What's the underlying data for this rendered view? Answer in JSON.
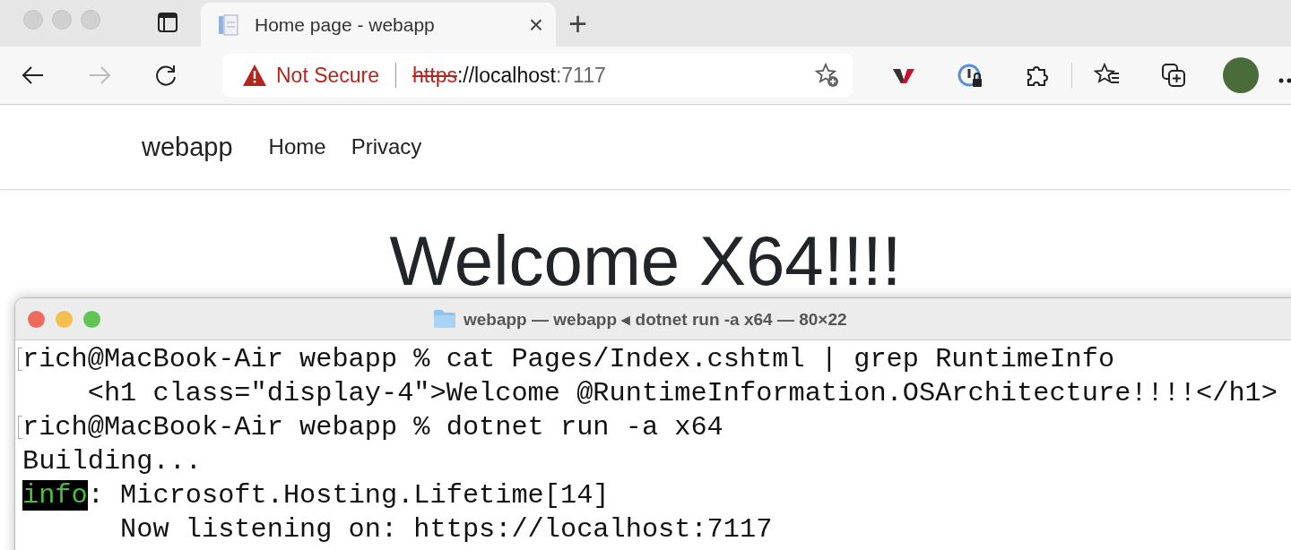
{
  "browser": {
    "tab": {
      "title": "Home page - webapp",
      "close": "×",
      "selected": true
    },
    "new_tab": "+",
    "address_bar": {
      "security": "Not Secure",
      "url": [
        {
          "text": "https",
          "kind": "struck"
        },
        {
          "text": "://localhost",
          "kind": "host"
        },
        {
          "text": ":7117",
          "kind": "port"
        }
      ]
    },
    "forward_disabled": true
  },
  "site": {
    "brand": "webapp",
    "nav": [
      "Home",
      "Privacy"
    ],
    "heading": "Welcome X64!!!!"
  },
  "terminal": {
    "title": "webapp — webapp ◂ dotnet run -a x64 — 80×22",
    "lines": [
      {
        "kind": "prompt",
        "segments": [
          {
            "text": "rich@MacBook-Air webapp % cat Pages/Index.cshtml | grep RuntimeInfo",
            "highlight": false
          }
        ]
      },
      {
        "kind": "output",
        "segments": [
          {
            "text": "    <h1 class=\"display-4\">Welcome @RuntimeInformation.OSArchitecture!!!!</h1>",
            "highlight": false
          }
        ]
      },
      {
        "kind": "prompt",
        "segments": [
          {
            "text": "rich@MacBook-Air webapp % dotnet run -a x64",
            "highlight": false
          }
        ]
      },
      {
        "kind": "output",
        "segments": [
          {
            "text": "Building...",
            "highlight": false
          }
        ]
      },
      {
        "kind": "output",
        "segments": [
          {
            "text": "info",
            "highlight": true
          },
          {
            "text": ": Microsoft.Hosting.Lifetime[14]",
            "highlight": false
          }
        ]
      },
      {
        "kind": "output",
        "segments": [
          {
            "text": "      Now listening on: https://localhost:7117",
            "highlight": false
          }
        ]
      }
    ]
  }
}
